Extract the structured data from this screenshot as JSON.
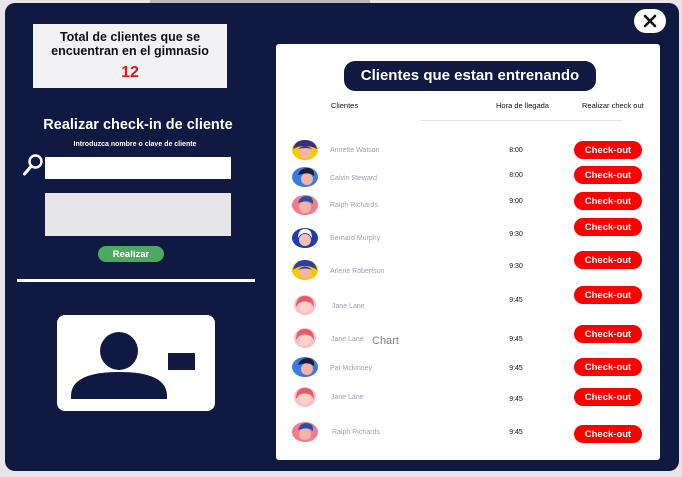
{
  "window": {
    "close_icon": "close-x-icon"
  },
  "summary": {
    "title": "Total de clientes que se encuentran en  el gimnasio",
    "count": "12"
  },
  "checkin": {
    "title": "Realizar check-in de cliente",
    "hint": "Introduzca nombre o clave de cliente",
    "search_placeholder": "",
    "search_icon": "search-icon",
    "button_label": "Realizar"
  },
  "panel": {
    "title": "Clientes que estan entrenando",
    "columns": [
      "Clientes",
      "Hora de llegada",
      "Realizar check out"
    ],
    "chart_label": "Chart",
    "checkout_label": "Check-out",
    "rows": [
      {
        "name": "Annette Watson",
        "time": "8:00",
        "avatar": "female-avatar-yellow-icon"
      },
      {
        "name": "Calvin Steward",
        "time": "8:00",
        "avatar": "male-avatar-blue-icon"
      },
      {
        "name": "Ralph Richards",
        "time": "9:00",
        "avatar": "male-avatar-pink-icon"
      },
      {
        "name": "Bernard Murphy",
        "time": "9:30",
        "avatar": "male-avatar-white-hair-icon"
      },
      {
        "name": "Arlene Robertson",
        "time": "9:30",
        "avatar": "female-avatar-yellow-icon"
      },
      {
        "name": "Jane Lane",
        "time": "9:45",
        "avatar": "female-avatar-pink-icon"
      },
      {
        "name": "Jane Lane",
        "time": "9:45",
        "avatar": "female-avatar-pink-icon"
      },
      {
        "name": "Pat Mckinney",
        "time": "9:45",
        "avatar": "male-avatar-blue-icon"
      },
      {
        "name": "Jane Lane",
        "time": "9:45",
        "avatar": "female-avatar-pink-icon"
      },
      {
        "name": "Ralph Richards",
        "time": "9:45",
        "avatar": "male-avatar-pink-icon"
      }
    ]
  },
  "colors": {
    "navy": "#0f1941",
    "checkout_red": "#ff0000",
    "count_red": "#e8141c",
    "button_green": "#4caa5e"
  }
}
